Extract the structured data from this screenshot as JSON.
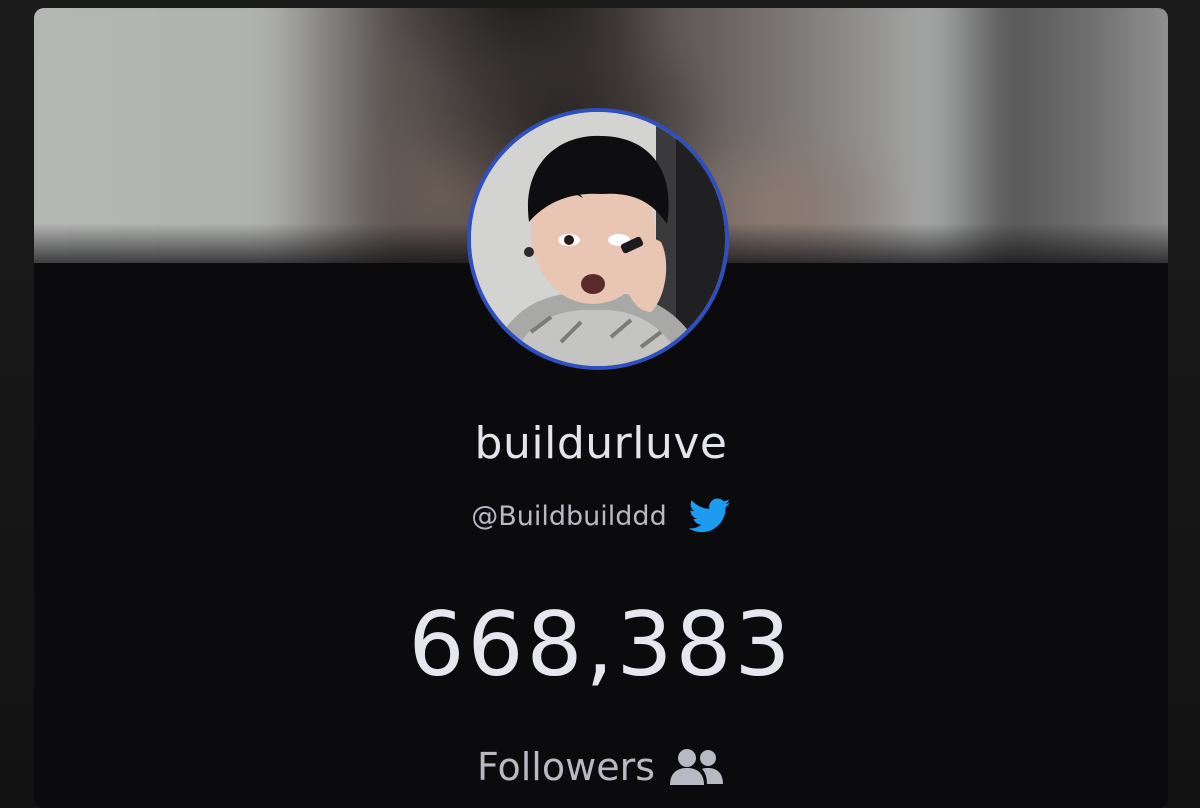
{
  "profile": {
    "display_name": "buildurluve",
    "handle": "@Buildbuilddd",
    "handle_platform_icon": "twitter-bird-icon",
    "avatar_border_color": "#2f4fbf",
    "avatar_image": "profile-photo"
  },
  "stats": {
    "followers_count": "668,383",
    "followers_label": "Followers",
    "followers_icon": "users-icon"
  },
  "banner": {
    "image": "blurred-banner-photo"
  },
  "colors": {
    "twitter_blue": "#1d9bf0",
    "card_background": "#0b0a0c"
  }
}
